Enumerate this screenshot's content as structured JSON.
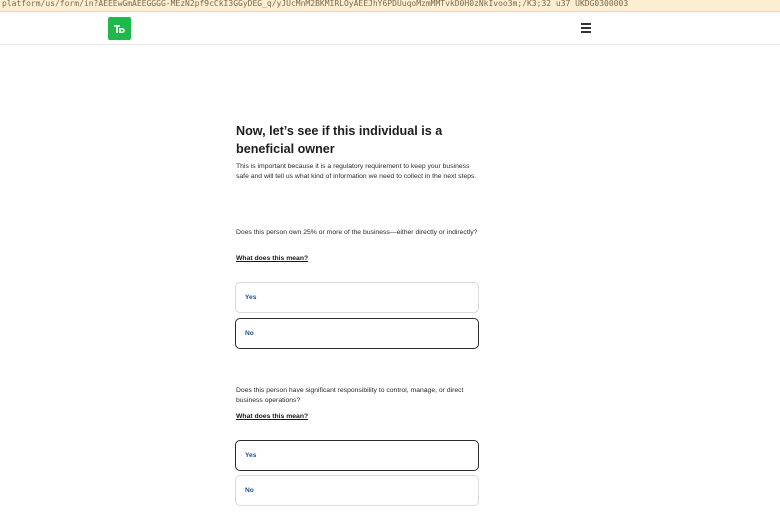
{
  "browser": {
    "url_fragment": "platform/us/form/in?AEEEwGmAEEGGGG-MEzN2pf9cCkI3GGyDEG_q/yJUcMnM2BKMIRLOyAEEJhY6PDUuqoMzmMMTvkD0H0zNkIvoo3m;/K3;32 u37 UKDG0300003"
  },
  "header": {
    "logo_label": "TD",
    "menu_icon": "hamburger-menu-icon"
  },
  "page": {
    "title": "Now, let’s see if this individual is a beneficial owner",
    "intro": "This is important because it is a regulatory requirement to keep your business safe and will tell us what kind of information we need to collect in the next steps."
  },
  "questions": [
    {
      "text": "Does this person own 25% or more of the business—either directly or indirectly?",
      "help_link": "What does this mean?",
      "options": [
        {
          "label": "Yes",
          "selected": false
        },
        {
          "label": "No",
          "selected": true
        }
      ]
    },
    {
      "text": "Does this person have significant responsibility to control, manage, or direct business operations?",
      "help_link": "What does this mean?",
      "options": [
        {
          "label": "Yes",
          "selected": true
        },
        {
          "label": "No",
          "selected": false
        }
      ]
    }
  ],
  "colors": {
    "brand_green": "#1fb84a",
    "option_text": "#1d4f91",
    "selected_border": "#2b2b2b"
  }
}
